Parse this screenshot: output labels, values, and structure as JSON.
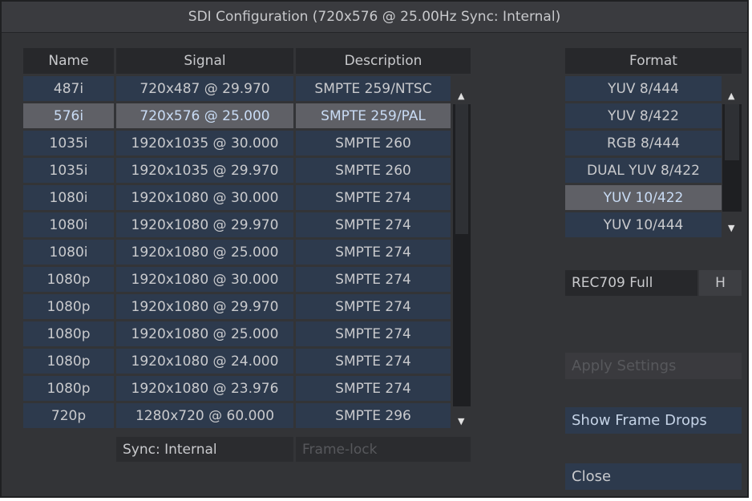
{
  "window": {
    "title": "SDI Configuration (720x576 @ 25.00Hz Sync: Internal)"
  },
  "table": {
    "headers": [
      "Name",
      "Signal",
      "Description"
    ],
    "selected_index": 1,
    "rows": [
      {
        "name": "487i",
        "signal": "720x487 @ 29.970",
        "description": "SMPTE 259/NTSC"
      },
      {
        "name": "576i",
        "signal": "720x576 @ 25.000",
        "description": "SMPTE 259/PAL"
      },
      {
        "name": "1035i",
        "signal": "1920x1035 @ 30.000",
        "description": "SMPTE 260"
      },
      {
        "name": "1035i",
        "signal": "1920x1035 @ 29.970",
        "description": "SMPTE 260"
      },
      {
        "name": "1080i",
        "signal": "1920x1080 @ 30.000",
        "description": "SMPTE 274"
      },
      {
        "name": "1080i",
        "signal": "1920x1080 @ 29.970",
        "description": "SMPTE 274"
      },
      {
        "name": "1080i",
        "signal": "1920x1080 @ 25.000",
        "description": "SMPTE 274"
      },
      {
        "name": "1080p",
        "signal": "1920x1080 @ 30.000",
        "description": "SMPTE 274"
      },
      {
        "name": "1080p",
        "signal": "1920x1080 @ 29.970",
        "description": "SMPTE 274"
      },
      {
        "name": "1080p",
        "signal": "1920x1080 @ 25.000",
        "description": "SMPTE 274"
      },
      {
        "name": "1080p",
        "signal": "1920x1080 @ 24.000",
        "description": "SMPTE 274"
      },
      {
        "name": "1080p",
        "signal": "1920x1080 @ 23.976",
        "description": "SMPTE 274"
      },
      {
        "name": "720p",
        "signal": "1280x720 @ 60.000",
        "description": "SMPTE 296"
      }
    ]
  },
  "sync_label": "Sync: Internal",
  "framelock_label": "Frame-lock",
  "format": {
    "header": "Format",
    "selected_index": 4,
    "items": [
      "YUV 8/444",
      "YUV 8/422",
      "RGB 8/444",
      "DUAL YUV 8/422",
      "YUV 10/422",
      "YUV 10/444"
    ]
  },
  "colorspace": {
    "label": "REC709 Full",
    "button": "H"
  },
  "buttons": {
    "apply": "Apply Settings",
    "frame_drops": "Show Frame Drops",
    "close": "Close"
  },
  "colors": {
    "cell_bg": "#2d3a4d",
    "selected_bg": "#5f6066",
    "selected_text": "#c9dcf5",
    "disabled_text": "#57585c"
  },
  "icons": {
    "scroll_up": "▲",
    "scroll_down": "▼"
  }
}
